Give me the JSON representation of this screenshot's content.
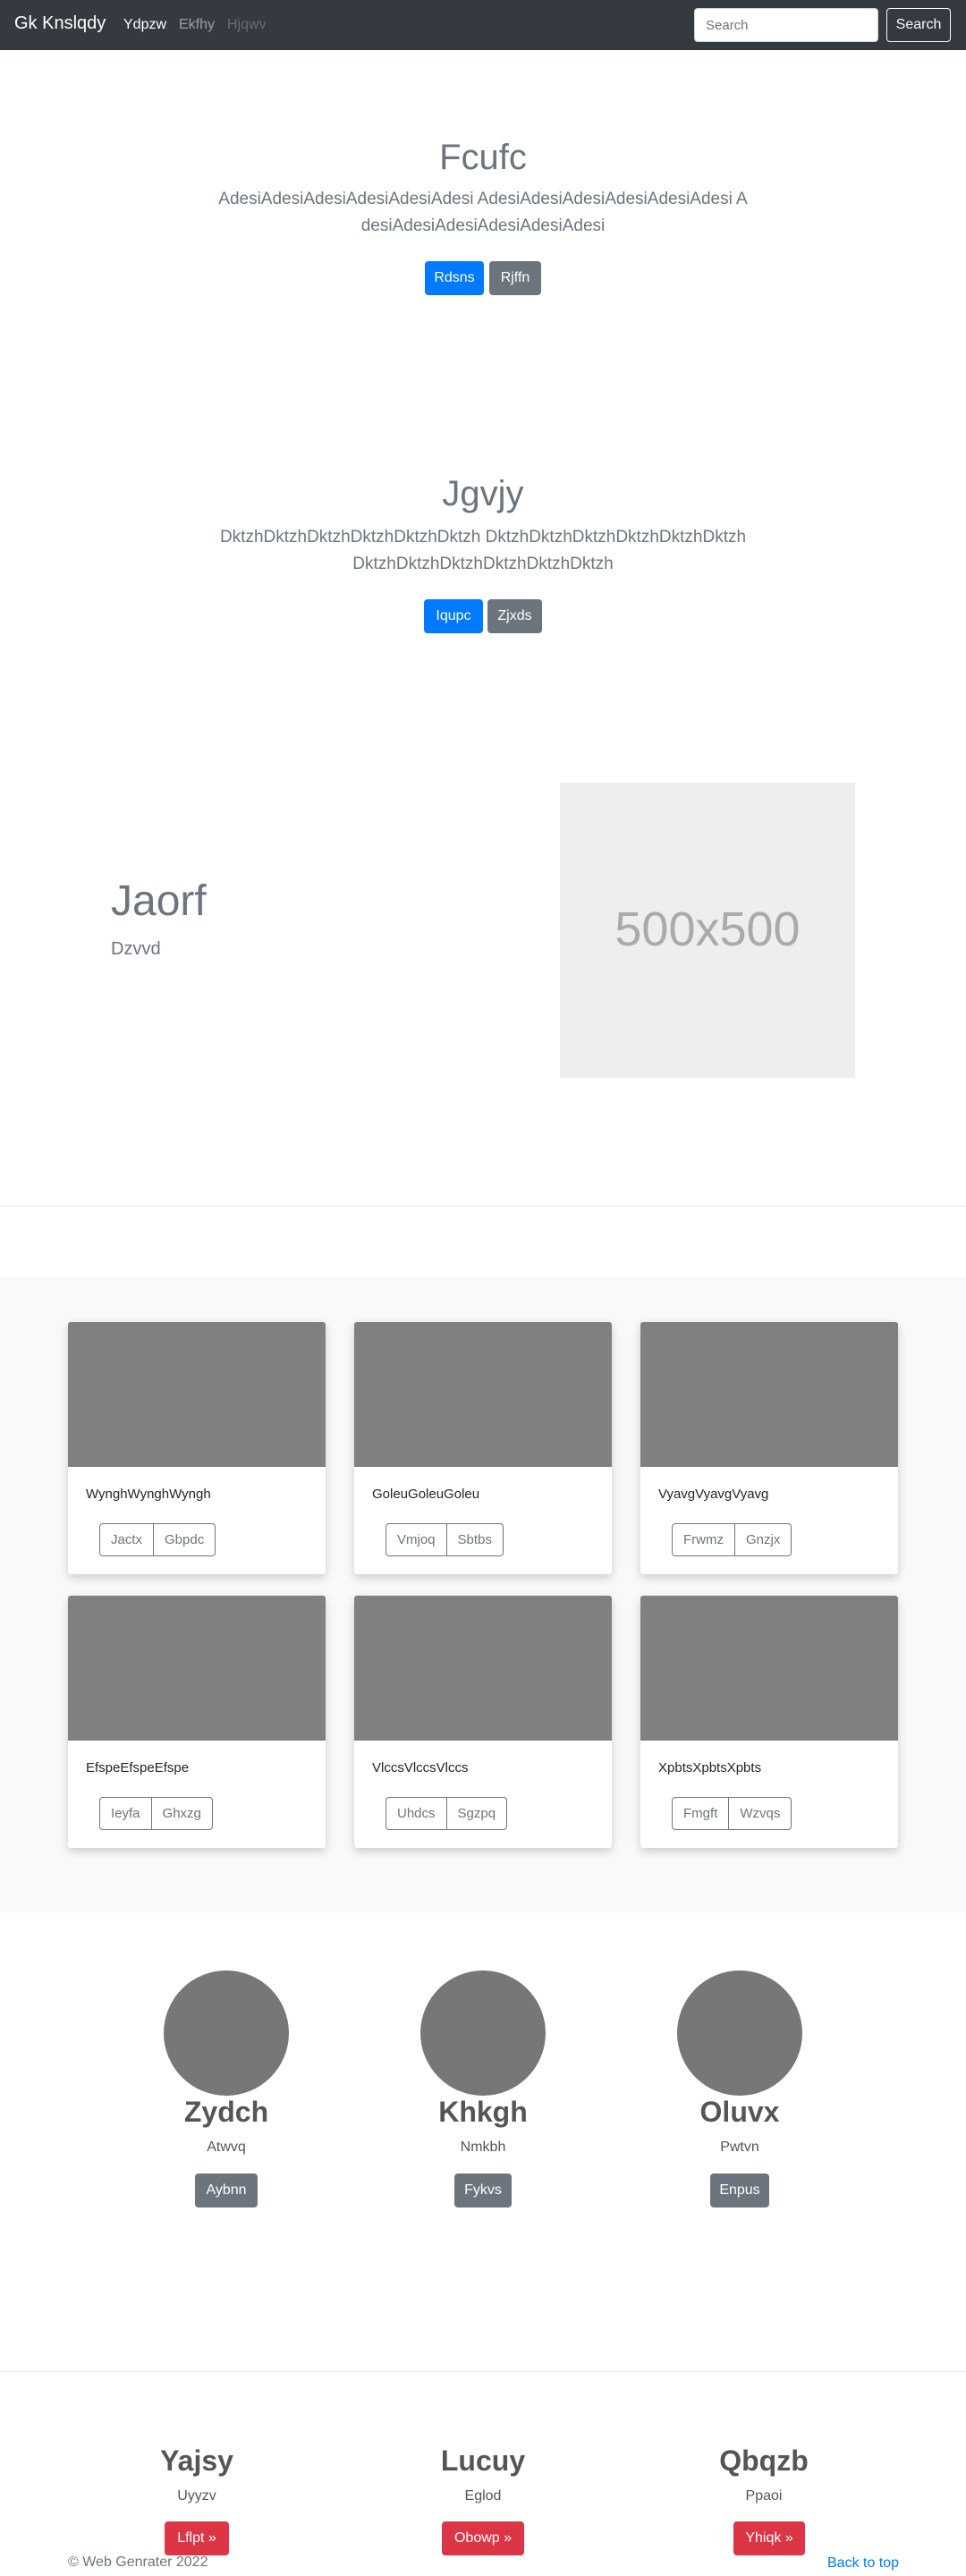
{
  "navbar": {
    "brand": "Gk Knslqdy",
    "links": [
      "Ydpzw",
      "Ekfhy",
      "Hjqwv"
    ],
    "search_placeholder": "Search",
    "search_button": "Search"
  },
  "hero1": {
    "title": "Fcufc",
    "lead": "AdesiAdesiAdesiAdesiAdesiAdesi AdesiAdesiAdesiAdesiAdesiAdesi AdesiAdesiAdesiAdesiAdesiAdesi",
    "primary_button": "Rdsns",
    "secondary_button": "Rjffn"
  },
  "hero2": {
    "title": "Jgvjy",
    "lead": "DktzhDktzhDktzhDktzhDktzhDktzh DktzhDktzhDktzhDktzhDktzhDktzh DktzhDktzhDktzhDktzhDktzhDktzh",
    "primary_button": "Iqupc",
    "secondary_button": "Zjxds"
  },
  "feature": {
    "heading": "Jaorf",
    "subheading": "Dzvvd",
    "image_label": "500x500"
  },
  "album": {
    "cards": [
      {
        "text": "WynghWynghWyngh",
        "buttons": [
          "Jactx",
          "Gbpdc"
        ]
      },
      {
        "text": "GoleuGoleuGoleu",
        "buttons": [
          "Vmjoq",
          "Sbtbs"
        ]
      },
      {
        "text": "VyavgVyavgVyavg",
        "buttons": [
          "Frwmz",
          "Gnzjx"
        ]
      },
      {
        "text": "EfspeEfspeEfspe",
        "buttons": [
          "Ieyfa",
          "Ghxzg"
        ]
      },
      {
        "text": "VlccsVlccsVlccs",
        "buttons": [
          "Uhdcs",
          "Sgzpq"
        ]
      },
      {
        "text": "XpbtsXpbtsXpbts",
        "buttons": [
          "Fmgft",
          "Wzvqs"
        ]
      }
    ]
  },
  "profiles": [
    {
      "name": "Zydch",
      "role": "Atwvq",
      "button": "Aybnn"
    },
    {
      "name": "Khkgh",
      "role": "Nmkbh",
      "button": "Fykvs"
    },
    {
      "name": "Oluvx",
      "role": "Pwtvn",
      "button": "Enpus"
    }
  ],
  "team": [
    {
      "name": "Yajsy",
      "role": "Uyyzv",
      "button": "Lflpt »"
    },
    {
      "name": "Lucuy",
      "role": "Eglod",
      "button": "Obowp »"
    },
    {
      "name": "Qbqzb",
      "role": "Ppaoi",
      "button": "Yhiqk »"
    }
  ],
  "footer": {
    "copyright": "© Web Genrater 2022",
    "back_to_top": "Back to top"
  },
  "colors": {
    "navbar_bg": "#343a40",
    "primary": "#007bff",
    "secondary": "#6c757d",
    "danger": "#dc3545"
  }
}
